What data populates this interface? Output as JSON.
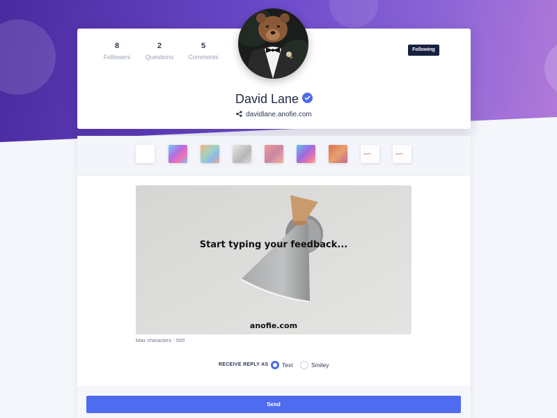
{
  "profile": {
    "name": "David Lane",
    "website": "davidlane.anofie.com",
    "follow_label": "Following",
    "stats": [
      {
        "value": "8",
        "label": "Followers"
      },
      {
        "value": "2",
        "label": "Questions"
      },
      {
        "value": "5",
        "label": "Comments"
      }
    ]
  },
  "backgrounds": {
    "swatches": [
      "white",
      "holographic",
      "pastel",
      "grey",
      "rose",
      "marble",
      "wood",
      "anofie-logo",
      "anofie-logo-alt"
    ],
    "logo_text": "anofie"
  },
  "feedback": {
    "placeholder": "Start typing your feedback...",
    "watermark": "anofie.com",
    "max_characters": "Max characters - 500"
  },
  "reply": {
    "label": "RECEIVE REPLY AS",
    "options": [
      {
        "label": "Text",
        "selected": true
      },
      {
        "label": "Smiley",
        "selected": false
      }
    ]
  },
  "send_label": "Send",
  "colors": {
    "accent": "#4f6bef",
    "follow_button": "#172040",
    "hero_start": "#4a2a9e",
    "hero_end": "#b27ad9"
  }
}
